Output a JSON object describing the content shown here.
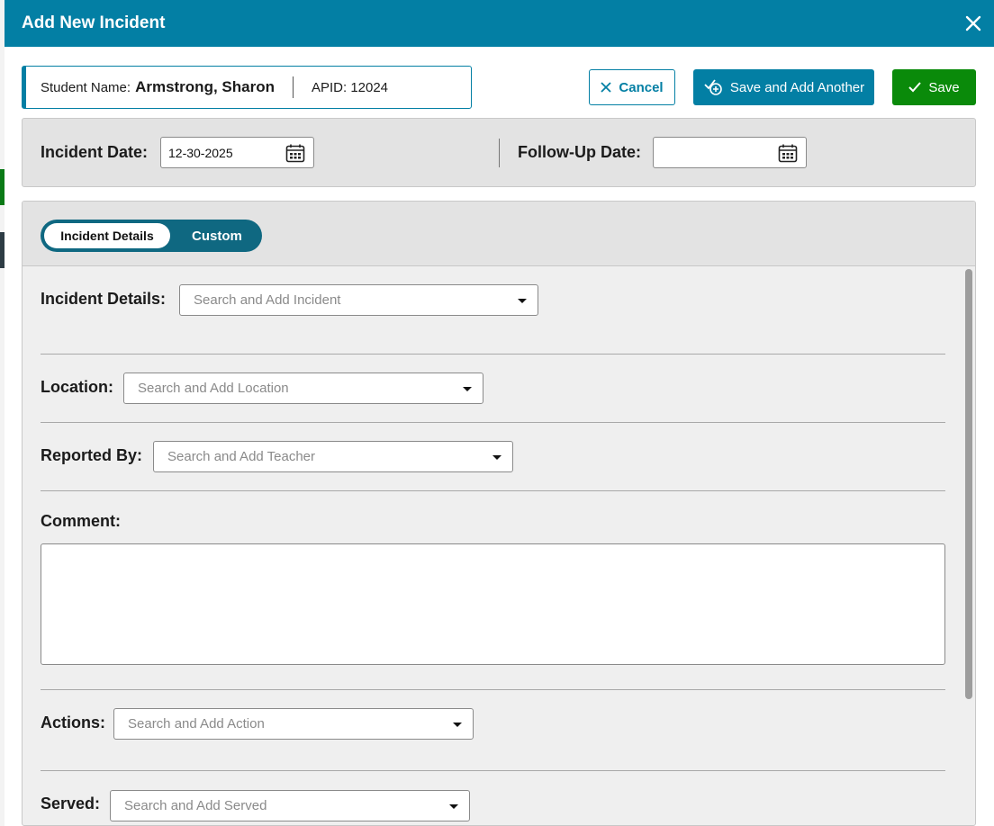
{
  "modal": {
    "title": "Add New Incident",
    "close_icon": "close-icon"
  },
  "student": {
    "name_label": "Student Name:",
    "name_value": "Armstrong, Sharon",
    "apid_text": "APID: 12024"
  },
  "toolbar": {
    "cancel_label": "Cancel",
    "save_another_label": "Save and Add Another",
    "save_label": "Save"
  },
  "dates": {
    "incident_label": "Incident Date:",
    "incident_value": "12-30-2025",
    "followup_label": "Follow-Up Date:",
    "followup_value": ""
  },
  "tabs": [
    {
      "label": "Incident Details",
      "active": true
    },
    {
      "label": "Custom",
      "active": false
    }
  ],
  "fields": {
    "incident": {
      "label": "Incident Details:",
      "placeholder": "Search and Add Incident"
    },
    "location": {
      "label": "Location:",
      "placeholder": "Search and Add Location"
    },
    "reported_by": {
      "label": "Reported By:",
      "placeholder": "Search and Add Teacher"
    },
    "comment": {
      "label": "Comment:",
      "value": ""
    },
    "actions": {
      "label": "Actions:",
      "placeholder": "Search and Add Action"
    },
    "served": {
      "label": "Served:",
      "placeholder": "Search and Add Served"
    }
  },
  "colors": {
    "header": "#037fa4",
    "save_green": "#0a8a0a",
    "toggle_dark": "#0f6881",
    "panel_bg": "#e3e3e3"
  }
}
